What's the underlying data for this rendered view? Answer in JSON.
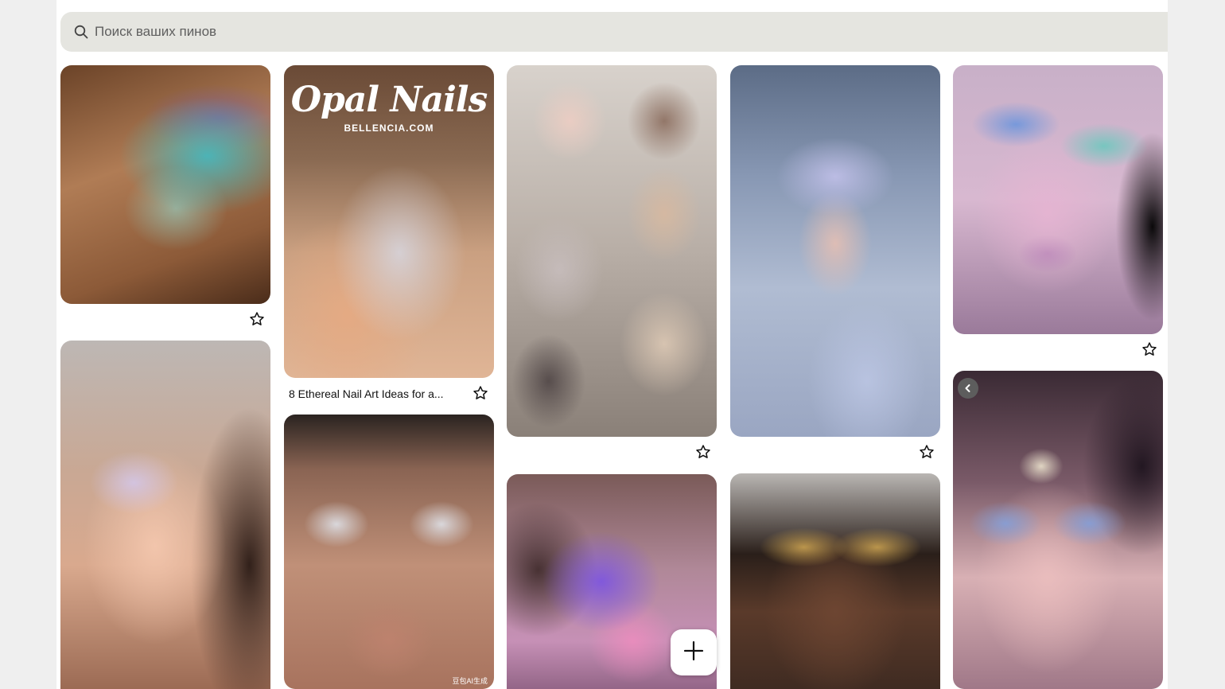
{
  "search": {
    "placeholder": "Поиск ваших пинов"
  },
  "pins": {
    "c1_p1": {
      "alt": "Iridescent glitter eye makeup with pearls",
      "title": ""
    },
    "c1_p2": {
      "alt": "Glowing holographic skin makeup portrait",
      "title": ""
    },
    "c2_p1": {
      "alt": "Opal nails manicure",
      "title": "8 Ethereal Nail Art Ideas for a...",
      "overlay_title": "Opal Nails",
      "overlay_site": "BELLENCIA.COM"
    },
    "c2_p2": {
      "alt": "Silver glitter eye makeup with freckles",
      "title": "",
      "watermark": "豆包AI生成"
    },
    "c3_p1": {
      "alt": "Pearl ethereal beauty collage",
      "title": ""
    },
    "c3_p2": {
      "alt": "Galaxy constellation face makeup",
      "title": ""
    },
    "c4_p1": {
      "alt": "Crystal headpiece holographic portrait",
      "title": ""
    },
    "c4_p2": {
      "alt": "Gold glitter makeup with star earrings",
      "title": ""
    },
    "c5_p1": {
      "alt": "Pastel holographic makeup with moon",
      "title": ""
    },
    "c5_p2": {
      "alt": "Moon forehead jewel fairy makeup",
      "title": ""
    }
  },
  "colors": {
    "panel_bg": "#ffffff",
    "page_bg": "#efefef",
    "search_bg": "#e5e5e0",
    "text": "#111111",
    "muted": "#5f5f5f"
  },
  "icons": {
    "search": "search-icon",
    "save": "star-outline-icon",
    "back": "chevron-left-icon",
    "add": "plus-icon"
  }
}
